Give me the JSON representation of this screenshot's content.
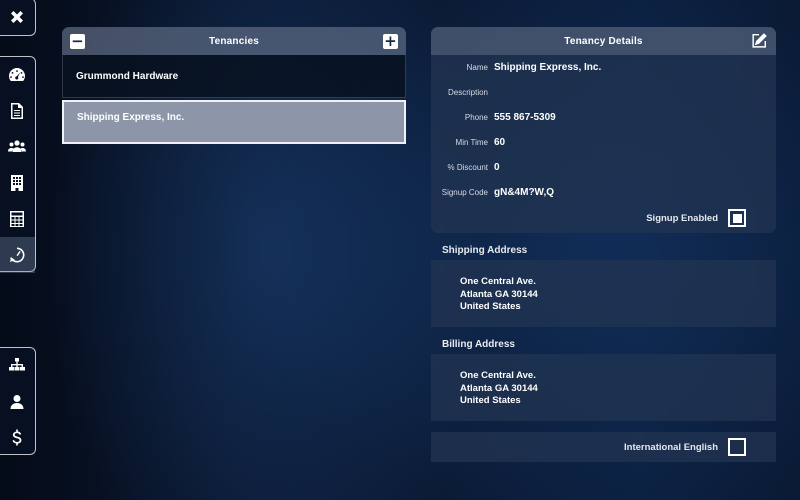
{
  "rail": {
    "close": {
      "icon": "close-icon"
    },
    "main": [
      {
        "icon": "dashboard-icon"
      },
      {
        "icon": "document-icon"
      },
      {
        "icon": "users-icon"
      },
      {
        "icon": "building-icon"
      },
      {
        "icon": "calculator-icon"
      },
      {
        "icon": "history-icon",
        "active": true
      }
    ],
    "bottom": [
      {
        "icon": "org-chart-icon"
      },
      {
        "icon": "user-icon"
      },
      {
        "icon": "dollar-icon"
      }
    ]
  },
  "tenancies": {
    "title": "Tenancies",
    "remove_label": "−",
    "add_label": "+",
    "items": [
      {
        "name": "Grummond Hardware",
        "selected": false
      },
      {
        "name": "Shipping Express, Inc.",
        "selected": true
      }
    ]
  },
  "details": {
    "title": "Tenancy Details",
    "fields": {
      "name": {
        "label": "Name",
        "value": "Shipping Express, Inc."
      },
      "description": {
        "label": "Description",
        "value": ""
      },
      "phone": {
        "label": "Phone",
        "value": "555 867-5309"
      },
      "min_time": {
        "label": "Min Time",
        "value": "60"
      },
      "discount": {
        "label": "% Discount",
        "value": "0"
      },
      "signup_code": {
        "label": "Signup Code",
        "value": "gN&4M?W,Q"
      }
    },
    "signup_enabled": {
      "label": "Signup Enabled",
      "checked": true
    }
  },
  "shipping": {
    "title": "Shipping Address",
    "line1": "One Central Ave.",
    "line2": "Atlanta GA 30144",
    "line3": "United States"
  },
  "billing": {
    "title": "Billing Address",
    "line1": "One Central Ave.",
    "line2": "Atlanta GA 30144",
    "line3": "United States"
  },
  "international": {
    "label": "International English",
    "checked": false
  },
  "colors": {
    "accent": "#ffffff",
    "panel": "#233452",
    "selected_row": "#8c96a8"
  }
}
